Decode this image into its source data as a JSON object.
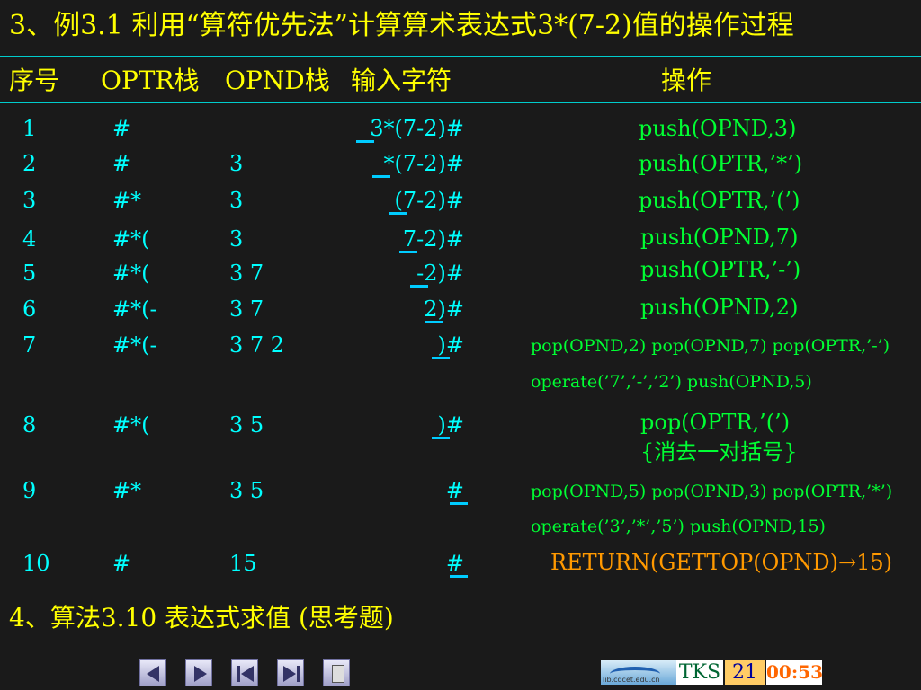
{
  "title": "3、例3.1 利用“算符优先法”计算算术表达式3*(7-2)值的操作过程",
  "headers": {
    "seq": "序号",
    "optr": "OPTR栈",
    "opnd": "OPND栈",
    "input": "输入字符",
    "operation": "操作"
  },
  "rows": [
    {
      "seq": "1",
      "optr": "#",
      "opnd": "",
      "input": "3*(7-2)#",
      "op": "push(OPND,3)"
    },
    {
      "seq": "2",
      "optr": "#",
      "opnd": "3",
      "input": "*(7-2)#",
      "op": "push(OPTR,’*’)"
    },
    {
      "seq": "3",
      "optr": "#*",
      "opnd": "3",
      "input": "(7-2)#",
      "op": "push(OPTR,’(’)"
    },
    {
      "seq": "4",
      "optr": "#*(",
      "opnd": "3",
      "input": "7-2)#",
      "op": "push(OPND,7)"
    },
    {
      "seq": "5",
      "optr": "#*(",
      "opnd": "3 7",
      "input": "-2)#",
      "op": "push(OPTR,’-’)"
    },
    {
      "seq": "6",
      "optr": "#*(-",
      "opnd": "3 7",
      "input": "2)#",
      "op": "push(OPND,2)"
    },
    {
      "seq": "7",
      "optr": "#*(-",
      "opnd": "3 7 2",
      "input": ")#",
      "op1": "pop(OPND,2) pop(OPND,7) pop(OPTR,’-’)",
      "op2": "operate(’7’,’-’,’2’) push(OPND,5)"
    },
    {
      "seq": "8",
      "optr": "#*(",
      "opnd": "3 5",
      "input": ")#",
      "op1": "pop(OPTR,’(’)",
      "op2": "{消去一对括号}"
    },
    {
      "seq": "9",
      "optr": "#*",
      "opnd": "3 5",
      "input": "#",
      "op1": "pop(OPND,5) pop(OPND,3) pop(OPTR,’*’)",
      "op2": "operate(’3’,’*’,’5’) push(OPND,15)"
    },
    {
      "seq": "10",
      "optr": "#",
      "opnd": "15",
      "input": "#",
      "op": "RETURN(GETTOP(OPND)→15)"
    }
  ],
  "footer": "4、算法3.10 表达式求值 (思考题)",
  "nav": {
    "logo_text": "lib.cqcet.edu.cn",
    "tks": "TKS",
    "page": "21",
    "time": "00:53"
  },
  "colors": {
    "background": "#1a1a1a",
    "title": "#ffff00",
    "table_text": "#00ffff",
    "operation": "#00ff33",
    "return": "#ff9900",
    "underline": "#00ccff"
  },
  "icons": [
    "prev-arrow-icon",
    "next-arrow-icon",
    "first-page-icon",
    "last-page-icon",
    "page-icon"
  ]
}
